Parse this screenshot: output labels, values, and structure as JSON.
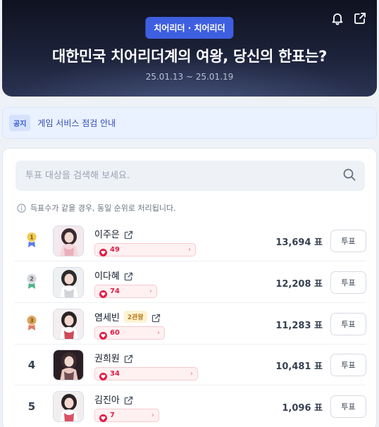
{
  "header": {
    "category": "치어리더 · 치어리더",
    "title": "대한민국 치어리더계의 여왕, 당신의 한표는?",
    "date_range": "25.01.13 ~ 25.01.19",
    "icons": [
      "bell-icon",
      "share-icon"
    ]
  },
  "notice": {
    "badge": "공지",
    "text": "게임 서비스 점검 안내"
  },
  "search": {
    "placeholder": "투표 대상을 검색해 보세요."
  },
  "info": {
    "text": "득표수가 같을 경우, 동일 순위로 처리됩니다."
  },
  "colors": {
    "accent": "#3d5fe0",
    "heart": "#e11d48",
    "gold": "#f2c94c",
    "silver": "#cfd6e1",
    "bronze": "#e0a35b"
  },
  "candidates": [
    {
      "rank": "1",
      "medal": "gold",
      "name": "이주은",
      "badge": "",
      "hearts": "49",
      "votes": "13,694 표",
      "vote_label": "투표"
    },
    {
      "rank": "2",
      "medal": "silver",
      "name": "이다혜",
      "badge": "",
      "hearts": "74",
      "votes": "12,208 표",
      "vote_label": "투표"
    },
    {
      "rank": "3",
      "medal": "bronze",
      "name": "염세빈",
      "badge": "2관왕",
      "hearts": "60",
      "votes": "11,283 표",
      "vote_label": "투표"
    },
    {
      "rank": "4",
      "medal": "",
      "name": "권희원",
      "badge": "",
      "hearts": "34",
      "votes": "10,481 표",
      "vote_label": "투표"
    },
    {
      "rank": "5",
      "medal": "",
      "name": "김진아",
      "badge": "",
      "hearts": "7",
      "votes": "1,096 표",
      "vote_label": "투표"
    }
  ]
}
